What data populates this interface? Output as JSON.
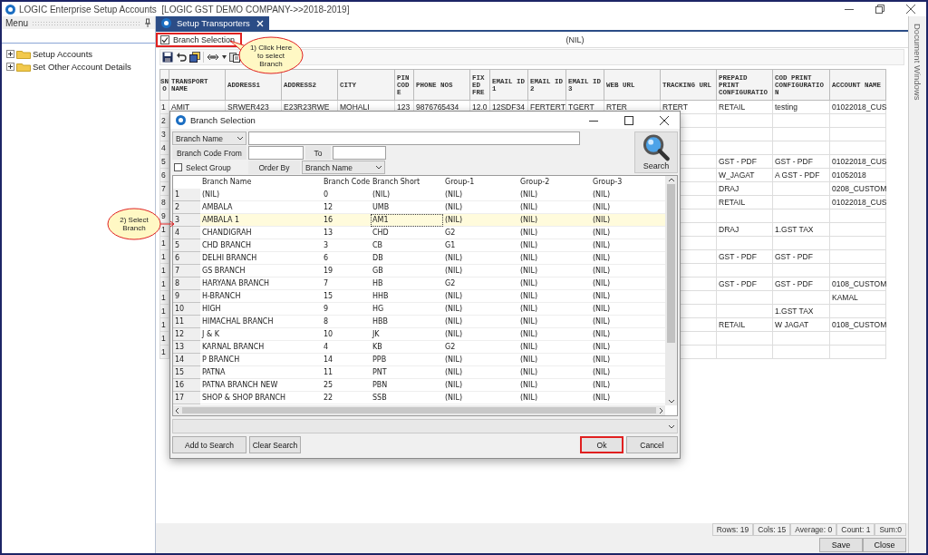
{
  "window": {
    "title": "LOGIC Enterprise Setup Accounts  [LOGIC GST DEMO COMPANY->>2018-2019]"
  },
  "menu_panel": {
    "title": "Menu",
    "tree": [
      {
        "label": "Setup Accounts",
        "expanded": false
      },
      {
        "label": "Set Other Account Details",
        "expanded": false
      }
    ]
  },
  "tabs": [
    {
      "label": "Setup Transporters",
      "selected": true
    }
  ],
  "branch_selection": {
    "label": "Branch Selection",
    "checked": true,
    "highlighted": true,
    "value": "(NIL)"
  },
  "grid": {
    "columns": [
      "SNO",
      "TRANSPORT NAME",
      "ADDRESS1",
      "ADDRESS2",
      "CITY",
      "PIN CODE",
      "PHONE NOS",
      "FIXED FRE",
      "EMAIL ID 1",
      "EMAIL ID 2",
      "EMAIL ID 3",
      "WEB URL",
      "TRACKING URL",
      "PREPAID PRINT CONFIGURATIO",
      "COD PRINT CONFIGURATION",
      "ACCOUNT NAME"
    ],
    "rows": [
      {
        "sno": "1",
        "transport_name": "AMIT",
        "address1": "SRWER423",
        "address2": "E23R23RWE",
        "city": "MOHALI",
        "pin_code": "123",
        "phone_nos": "9876765434",
        "fixed_fre": "12.0",
        "email_id_1": "12SDF34",
        "email_id_2": "FERTERT",
        "email_id_3": "TGERT",
        "web_url": "RTER",
        "tracking_url": "RTERT",
        "prepaid_print_configuration": "RETAIL",
        "cod_print_configuration": "testing",
        "account_name": "01022018_CUS"
      },
      {
        "sno": "2"
      },
      {
        "sno": "3"
      },
      {
        "sno": "4"
      },
      {
        "sno": "5",
        "prepaid_print_configuration": "GST - PDF",
        "cod_print_configuration": "GST - PDF",
        "account_name": "01022018_CUS"
      },
      {
        "sno": "6",
        "prepaid_print_configuration": "W_JAGAT",
        "cod_print_configuration": "A GST - PDF",
        "account_name": "01052018"
      },
      {
        "sno": "7",
        "prepaid_print_configuration": "DRAJ",
        "account_name": "0208_CUSTOM"
      },
      {
        "sno": "8",
        "prepaid_print_configuration": "RETAIL",
        "account_name": "01022018_CUS"
      },
      {
        "sno": "9"
      },
      {
        "sno": "1",
        "prepaid_print_configuration": "DRAJ",
        "cod_print_configuration": "1.GST TAX"
      },
      {
        "sno": "1"
      },
      {
        "sno": "1",
        "prepaid_print_configuration": "GST - PDF",
        "cod_print_configuration": "GST - PDF"
      },
      {
        "sno": "1"
      },
      {
        "sno": "1",
        "prepaid_print_configuration": "GST - PDF",
        "cod_print_configuration": "GST - PDF",
        "account_name": "0108_CUSTOM"
      },
      {
        "sno": "1",
        "account_name": "KAMAL"
      },
      {
        "sno": "1",
        "cod_print_configuration": "1.GST TAX"
      },
      {
        "sno": "1",
        "prepaid_print_configuration": "RETAIL",
        "cod_print_configuration": "W JAGAT",
        "account_name": "0108_CUSTOM"
      },
      {
        "sno": "1"
      },
      {
        "sno": "1"
      }
    ]
  },
  "callouts": [
    {
      "text": "1) Click Here to select Branch"
    },
    {
      "text": "2) Select Branch"
    }
  ],
  "dialog": {
    "title": "Branch Selection",
    "filter_by": {
      "value": "Branch Name"
    },
    "code_from_label": "Branch Code From",
    "to_label": "To",
    "select_group": {
      "label": "Select Group",
      "checked": false
    },
    "order_by_label": "Order By",
    "order_by": {
      "value": "Branch Name"
    },
    "search_button": "Search",
    "columns": [
      "Branch Name",
      "Branch Code",
      "Branch Short",
      "Group-1",
      "Group-2",
      "Group-3"
    ],
    "rows": [
      {
        "no": "1",
        "cells": [
          "(NIL)",
          "0",
          "(NIL)",
          "(NIL)",
          "(NIL)",
          "(NIL)"
        ],
        "selected": false
      },
      {
        "no": "2",
        "cells": [
          "AMBALA",
          "12",
          "UMB",
          "(NIL)",
          "(NIL)",
          "(NIL)"
        ],
        "selected": false
      },
      {
        "no": "3",
        "cells": [
          "AMBALA 1",
          "16",
          "AM1",
          "(NIL)",
          "(NIL)",
          "(NIL)"
        ],
        "selected": true
      },
      {
        "no": "4",
        "cells": [
          "CHANDIGRAH",
          "13",
          "CHD",
          "G2",
          "(NIL)",
          "(NIL)"
        ],
        "selected": false
      },
      {
        "no": "5",
        "cells": [
          "CHD BRANCH",
          "3",
          "CB",
          "G1",
          "(NIL)",
          "(NIL)"
        ],
        "selected": false
      },
      {
        "no": "6",
        "cells": [
          "DELHI BRANCH",
          "6",
          "DB",
          "(NIL)",
          "(NIL)",
          "(NIL)"
        ],
        "selected": false
      },
      {
        "no": "7",
        "cells": [
          "GS BRANCH",
          "19",
          "GB",
          "(NIL)",
          "(NIL)",
          "(NIL)"
        ],
        "selected": false
      },
      {
        "no": "8",
        "cells": [
          "HARYANA BRANCH",
          "7",
          "HB",
          "G2",
          "(NIL)",
          "(NIL)"
        ],
        "selected": false
      },
      {
        "no": "9",
        "cells": [
          "H-BRANCH",
          "15",
          "HHB",
          "(NIL)",
          "(NIL)",
          "(NIL)"
        ],
        "selected": false
      },
      {
        "no": "10",
        "cells": [
          "HIGH",
          "9",
          "HG",
          "(NIL)",
          "(NIL)",
          "(NIL)"
        ],
        "selected": false
      },
      {
        "no": "11",
        "cells": [
          "HIMACHAL BRANCH",
          "8",
          "HBB",
          "(NIL)",
          "(NIL)",
          "(NIL)"
        ],
        "selected": false
      },
      {
        "no": "12",
        "cells": [
          "J & K",
          "10",
          "JK",
          "(NIL)",
          "(NIL)",
          "(NIL)"
        ],
        "selected": false
      },
      {
        "no": "13",
        "cells": [
          "KARNAL BRANCH",
          "4",
          "KB",
          "G2",
          "(NIL)",
          "(NIL)"
        ],
        "selected": false
      },
      {
        "no": "14",
        "cells": [
          "P BRANCH",
          "14",
          "PPB",
          "(NIL)",
          "(NIL)",
          "(NIL)"
        ],
        "selected": false
      },
      {
        "no": "15",
        "cells": [
          "PATNA",
          "11",
          "PNT",
          "(NIL)",
          "(NIL)",
          "(NIL)"
        ],
        "selected": false
      },
      {
        "no": "16",
        "cells": [
          "PATNA BRANCH NEW",
          "25",
          "PBN",
          "(NIL)",
          "(NIL)",
          "(NIL)"
        ],
        "selected": false
      },
      {
        "no": "17",
        "cells": [
          "SHOP & SHOP BRANCH",
          "22",
          "SSB",
          "(NIL)",
          "(NIL)",
          "(NIL)"
        ],
        "selected": false
      }
    ],
    "buttons": [
      {
        "label": "Add to Search",
        "highlighted": false
      },
      {
        "label": "Clear Search",
        "highlighted": false
      },
      {
        "label": "Ok",
        "highlighted": true
      },
      {
        "label": "Cancel",
        "highlighted": false
      }
    ]
  },
  "status_bar": [
    "Rows: 19",
    "Cols: 15",
    "Average: 0",
    "Count: 1",
    "Sum:0"
  ],
  "bottom_buttons": [
    "Save",
    "Close"
  ],
  "side_panel": {
    "title": "Document Windows"
  }
}
